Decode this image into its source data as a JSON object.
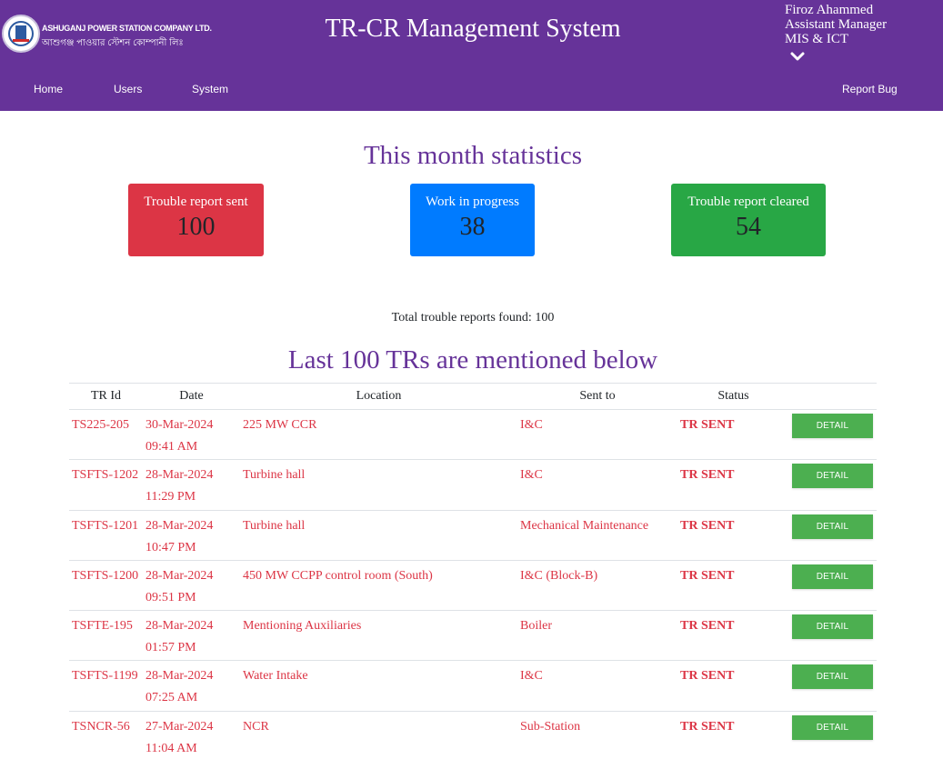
{
  "header": {
    "logo_line1": "ASHUGANJ POWER STATION COMPANY LTD.",
    "logo_line2": "আশুগঞ্জ পাওয়ার স্টেশন কোম্পানী লিঃ",
    "title": "TR-CR Management System",
    "user": {
      "name": "Firoz Ahammed",
      "designation": "Assistant Manager",
      "department": "MIS & ICT"
    },
    "colors": {
      "background": "#663399",
      "text": "#ffffff"
    }
  },
  "nav": {
    "home": "Home",
    "users": "Users",
    "system": "System",
    "report_bug": "Report Bug"
  },
  "stats": {
    "title": "This month statistics",
    "cards": [
      {
        "label": "Trouble report sent",
        "value": "100",
        "color": "#dc3545"
      },
      {
        "label": "Work in progress",
        "value": "38",
        "color": "#007bff"
      },
      {
        "label": "Trouble report cleared",
        "value": "54",
        "color": "#28a745"
      }
    ]
  },
  "total_text": "Total trouble reports found: 100",
  "list_title": "Last 100 TRs are mentioned below",
  "table": {
    "headers": [
      "TR Id",
      "Date",
      "Location",
      "Sent to",
      "Status",
      ""
    ],
    "detail_label": "DETAIL",
    "rows": [
      {
        "id": "TS225-205",
        "date": "30-Mar-2024",
        "time": "09:41 AM",
        "location": "225 MW CCR",
        "sent_to": "I&C",
        "status": "TR SENT"
      },
      {
        "id": "TSFTS-1202",
        "date": "28-Mar-2024",
        "time": "11:29 PM",
        "location": "Turbine hall",
        "sent_to": "I&C",
        "status": "TR SENT"
      },
      {
        "id": "TSFTS-1201",
        "date": "28-Mar-2024",
        "time": "10:47 PM",
        "location": "Turbine hall",
        "sent_to": "Mechanical Maintenance",
        "status": "TR SENT"
      },
      {
        "id": "TSFTS-1200",
        "date": "28-Mar-2024",
        "time": "09:51 PM",
        "location": "450 MW CCPP control room (South)",
        "sent_to": "I&C (Block-B)",
        "status": "TR SENT"
      },
      {
        "id": "TSFTE-195",
        "date": "28-Mar-2024",
        "time": "01:57 PM",
        "location": "Mentioning Auxiliaries",
        "sent_to": "Boiler",
        "status": "TR SENT"
      },
      {
        "id": "TSFTS-1199",
        "date": "28-Mar-2024",
        "time": "07:25 AM",
        "location": "Water Intake",
        "sent_to": "I&C",
        "status": "TR SENT"
      },
      {
        "id": "TSNCR-56",
        "date": "27-Mar-2024",
        "time": "11:04 AM",
        "location": "NCR",
        "sent_to": "Sub-Station",
        "status": "TR SENT"
      }
    ],
    "colors": {
      "row_text": "#dc3545",
      "detail_button": "#4caf50"
    }
  }
}
